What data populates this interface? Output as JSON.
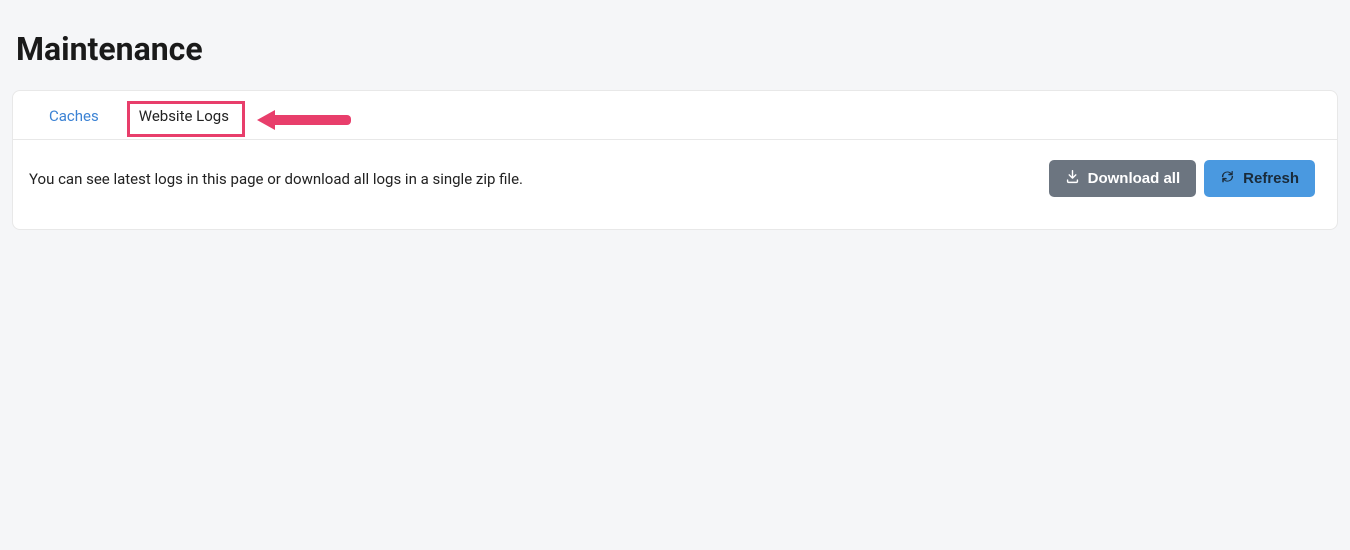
{
  "page": {
    "title": "Maintenance"
  },
  "tabs": {
    "items": [
      {
        "label": "Caches",
        "active": false
      },
      {
        "label": "Website Logs",
        "active": true
      }
    ]
  },
  "content": {
    "description": "You can see latest logs in this page or download all logs in a single zip file."
  },
  "buttons": {
    "download_all": "Download all",
    "refresh": "Refresh"
  },
  "annotation": {
    "highlight_tab_index": 1
  }
}
